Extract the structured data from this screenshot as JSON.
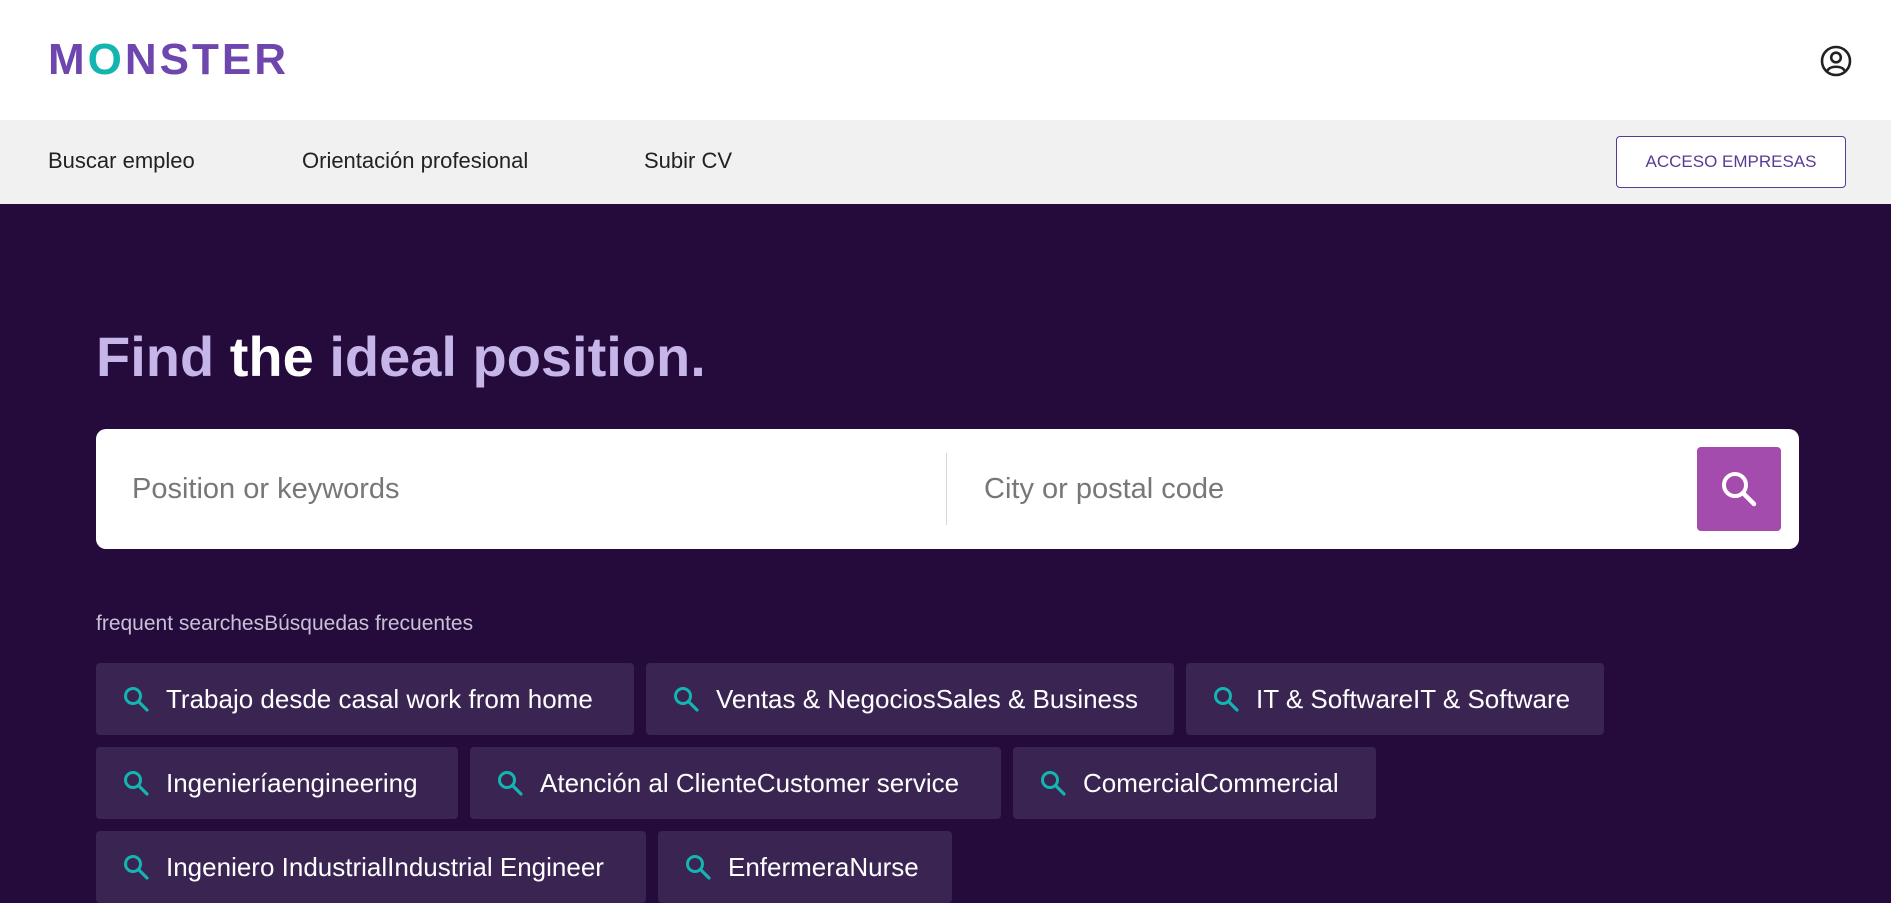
{
  "brand": {
    "name_pre": "M",
    "name_o": "O",
    "name_post": "NSTER"
  },
  "nav": {
    "items": [
      "Buscar empleo",
      "Orientación profesional",
      "Subir CV"
    ],
    "employer_button": "ACCESO EMPRESAS"
  },
  "hero": {
    "title_part1": "Find ",
    "title_part2": "the ",
    "title_part3": "ideal position."
  },
  "search": {
    "keywords_placeholder": "Position or keywords",
    "location_placeholder": "City or postal code"
  },
  "frequent": {
    "label": "frequent searchesBúsquedas frecuentes",
    "chips": [
      "Trabajo desde casal work from home",
      "Ventas & NegociosSales & Business",
      "IT & SoftwareIT & Software",
      "Ingenieríaengineering",
      "Atención al ClienteCustomer service",
      "ComercialCommercial",
      "Ingeniero IndustrialIndustrial Engineer",
      "EnfermeraNurse"
    ]
  },
  "colors": {
    "brand_purple": "#6e46ae",
    "brand_teal": "#13b5b1",
    "hero_bg": "#240b3b",
    "search_button": "#a44bae",
    "chip_bg": "#3a2452"
  },
  "icons": {
    "account": "user-circle-icon",
    "search": "search-icon"
  }
}
